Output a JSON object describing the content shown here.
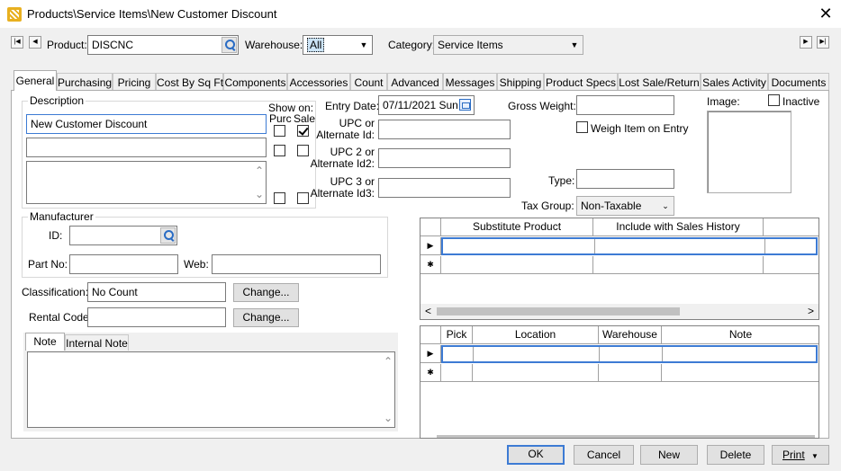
{
  "window": {
    "title": "Products\\Service Items\\New Customer Discount",
    "close": "✕"
  },
  "header": {
    "product_label": "Product:",
    "product_value": "DISCNC",
    "warehouse_label": "Warehouse:",
    "warehouse_value": "All",
    "category_label": "Category:",
    "category_value": "Service Items",
    "first": "◀◀",
    "prev": "◀",
    "next": "▶",
    "last": "▶▶"
  },
  "tabs": [
    {
      "label": "General"
    },
    {
      "label": "Purchasing"
    },
    {
      "label": "Pricing"
    },
    {
      "label": "Cost By Sq Ft"
    },
    {
      "label": "Components"
    },
    {
      "label": "Accessories"
    },
    {
      "label": "Count"
    },
    {
      "label": "Advanced"
    },
    {
      "label": "Messages"
    },
    {
      "label": "Shipping"
    },
    {
      "label": "Product Specs"
    },
    {
      "label": "Lost Sale/Return"
    },
    {
      "label": "Sales Activity"
    },
    {
      "label": "Documents"
    }
  ],
  "description": {
    "caption": "Description",
    "line1": "New Customer Discount",
    "line2": "",
    "long": "",
    "show_on_label": "Show on:",
    "purc_label": "Purc",
    "sale_label": "Sale"
  },
  "manufacturer": {
    "caption": "Manufacturer",
    "id_label": "ID:",
    "id_value": "",
    "partno_label": "Part No:",
    "partno_value": "",
    "web_label": "Web:",
    "web_value": ""
  },
  "classification": {
    "label": "Classification:",
    "value": "No Count",
    "change": "Change..."
  },
  "rental": {
    "label": "Rental Code:",
    "value": "",
    "change": "Change..."
  },
  "notes": {
    "tab_note": "Note",
    "tab_internal": "Internal Note",
    "value": ""
  },
  "fields": {
    "entry_date_label": "Entry Date:",
    "entry_date_value": "07/11/2021 Sun",
    "upc_label_1": "UPC or",
    "upc_label_2": "Alternate Id:",
    "upc2_label_1": "UPC 2 or",
    "upc2_label_2": "Alternate Id2:",
    "upc3_label_1": "UPC 3 or",
    "upc3_label_2": "Alternate Id3:",
    "gross_weight_label": "Gross Weight:",
    "gross_weight_value": "",
    "weigh_label": "Weigh Item on Entry",
    "type_label": "Type:",
    "type_value": "",
    "tax_group_label": "Tax Group:",
    "tax_group_value": "Non-Taxable",
    "image_label": "Image:",
    "inactive_label": "Inactive"
  },
  "substitute_grid": {
    "columns": [
      "Substitute Product",
      "Include with Sales History"
    ],
    "row_marker": "▶",
    "new_marker": "✱"
  },
  "location_grid": {
    "columns": [
      "Pick",
      "Location",
      "Warehouse",
      "Note"
    ],
    "row_marker": "▶",
    "new_marker": "✱"
  },
  "buttons": {
    "ok": "OK",
    "cancel": "Cancel",
    "new": "New",
    "delete": "Delete",
    "print": "Print",
    "print_arrow": "▼"
  },
  "icons": {
    "dropdown": "▼",
    "scroll_up": "⌃",
    "scroll_down": "⌄",
    "scroll_left": "<",
    "scroll_right": ">"
  }
}
